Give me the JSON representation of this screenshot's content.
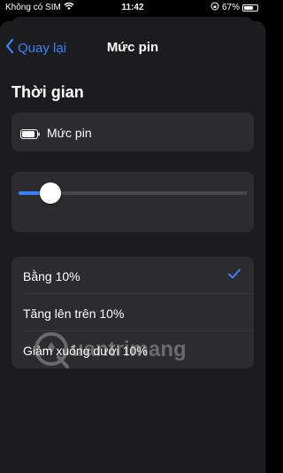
{
  "status_bar": {
    "carrier": "Không có SIM",
    "time": "11:42",
    "battery": "67%"
  },
  "nav": {
    "back_label": "Quay lại",
    "title": "Mức pin"
  },
  "section": {
    "title": "Thời gian"
  },
  "battery_row": {
    "label": "Mức pin"
  },
  "slider": {
    "value_fraction": 0.14
  },
  "options": [
    {
      "label": "Bằng 10%",
      "selected": true
    },
    {
      "label": "Tăng lên trên 10%",
      "selected": false
    },
    {
      "label": "Giảm xuống dưới 10%",
      "selected": false
    }
  ],
  "colors": {
    "accent": "#3a82f7",
    "background": "#000000",
    "card": "#2c2c2e"
  },
  "watermark": {
    "text": "uantrimang"
  }
}
